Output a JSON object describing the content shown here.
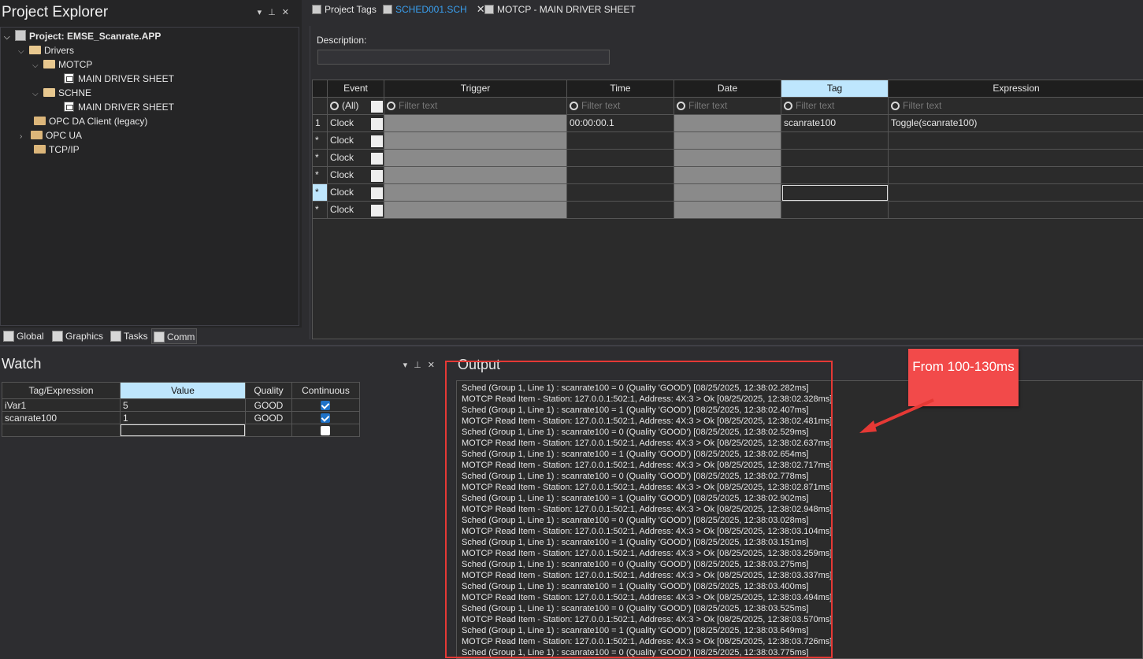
{
  "project_explorer": {
    "title": "Project Explorer",
    "tree": [
      {
        "label": "Project: EMSE_Scanrate.APP",
        "icon": "project-icon"
      },
      {
        "label": "Drivers",
        "icon": "folder-open-icon"
      },
      {
        "label": "MOTCP",
        "icon": "folder-open-icon"
      },
      {
        "label": "MAIN DRIVER SHEET",
        "icon": "driver-sheet-icon"
      },
      {
        "label": "SCHNE",
        "icon": "folder-open-icon"
      },
      {
        "label": "MAIN DRIVER SHEET",
        "icon": "driver-sheet-icon"
      },
      {
        "label": "OPC DA Client (legacy)",
        "icon": "folder-icon"
      },
      {
        "label": "OPC UA",
        "icon": "folder-icon"
      },
      {
        "label": "TCP/IP",
        "icon": "folder-icon"
      }
    ],
    "bottom_tabs": [
      "Global",
      "Graphics",
      "Tasks",
      "Comm"
    ]
  },
  "doc_tabs": [
    {
      "label": "Project Tags"
    },
    {
      "label": "SCHED001.SCH"
    },
    {
      "label": "MOTCP - MAIN DRIVER SHEET"
    }
  ],
  "schedule": {
    "description_label": "Description:",
    "columns": [
      "Event",
      "Trigger",
      "Time",
      "Date",
      "Tag",
      "Expression"
    ],
    "filter_all": "(All)",
    "filter_placeholder": "Filter text",
    "rows": [
      {
        "marker": "1",
        "event": "Clock",
        "time": "00:00:00.1",
        "tag": "scanrate100",
        "expression": "Toggle(scanrate100)"
      },
      {
        "marker": "*",
        "event": "Clock",
        "time": "",
        "tag": "",
        "expression": ""
      },
      {
        "marker": "*",
        "event": "Clock",
        "time": "",
        "tag": "",
        "expression": ""
      },
      {
        "marker": "*",
        "event": "Clock",
        "time": "",
        "tag": "",
        "expression": ""
      },
      {
        "marker": "*",
        "event": "Clock",
        "time": "",
        "tag": "",
        "expression": ""
      },
      {
        "marker": "*",
        "event": "Clock",
        "time": "",
        "tag": "",
        "expression": ""
      }
    ]
  },
  "watch": {
    "title": "Watch",
    "columns": [
      "Tag/Expression",
      "Value",
      "Quality",
      "Continuous"
    ],
    "rows": [
      {
        "tag": "iVar1",
        "value": "5",
        "quality": "GOOD",
        "continuous": true
      },
      {
        "tag": "scanrate100",
        "value": "1",
        "quality": "GOOD",
        "continuous": true
      }
    ]
  },
  "output": {
    "title": "Output",
    "lines": [
      "Sched (Group 1, Line 1) : scanrate100 = 0 (Quality 'GOOD') [08/25/2025, 12:38:02.282ms]",
      "MOTCP Read Item - Station: 127.0.0.1:502:1, Address: 4X:3 > Ok [08/25/2025, 12:38:02.328ms]",
      "Sched (Group 1, Line 1) : scanrate100 = 1 (Quality 'GOOD') [08/25/2025, 12:38:02.407ms]",
      "MOTCP Read Item - Station: 127.0.0.1:502:1, Address: 4X:3 > Ok [08/25/2025, 12:38:02.481ms]",
      "Sched (Group 1, Line 1) : scanrate100 = 0 (Quality 'GOOD') [08/25/2025, 12:38:02.529ms]",
      "MOTCP Read Item - Station: 127.0.0.1:502:1, Address: 4X:3 > Ok [08/25/2025, 12:38:02.637ms]",
      "Sched (Group 1, Line 1) : scanrate100 = 1 (Quality 'GOOD') [08/25/2025, 12:38:02.654ms]",
      "MOTCP Read Item - Station: 127.0.0.1:502:1, Address: 4X:3 > Ok [08/25/2025, 12:38:02.717ms]",
      "Sched (Group 1, Line 1) : scanrate100 = 0 (Quality 'GOOD') [08/25/2025, 12:38:02.778ms]",
      "MOTCP Read Item - Station: 127.0.0.1:502:1, Address: 4X:3 > Ok [08/25/2025, 12:38:02.871ms]",
      "Sched (Group 1, Line 1) : scanrate100 = 1 (Quality 'GOOD') [08/25/2025, 12:38:02.902ms]",
      "MOTCP Read Item - Station: 127.0.0.1:502:1, Address: 4X:3 > Ok [08/25/2025, 12:38:02.948ms]",
      "Sched (Group 1, Line 1) : scanrate100 = 0 (Quality 'GOOD') [08/25/2025, 12:38:03.028ms]",
      "MOTCP Read Item - Station: 127.0.0.1:502:1, Address: 4X:3 > Ok [08/25/2025, 12:38:03.104ms]",
      "Sched (Group 1, Line 1) : scanrate100 = 1 (Quality 'GOOD') [08/25/2025, 12:38:03.151ms]",
      "MOTCP Read Item - Station: 127.0.0.1:502:1, Address: 4X:3 > Ok [08/25/2025, 12:38:03.259ms]",
      "Sched (Group 1, Line 1) : scanrate100 = 0 (Quality 'GOOD') [08/25/2025, 12:38:03.275ms]",
      "MOTCP Read Item - Station: 127.0.0.1:502:1, Address: 4X:3 > Ok [08/25/2025, 12:38:03.337ms]",
      "Sched (Group 1, Line 1) : scanrate100 = 1 (Quality 'GOOD') [08/25/2025, 12:38:03.400ms]",
      "MOTCP Read Item - Station: 127.0.0.1:502:1, Address: 4X:3 > Ok [08/25/2025, 12:38:03.494ms]",
      "Sched (Group 1, Line 1) : scanrate100 = 0 (Quality 'GOOD') [08/25/2025, 12:38:03.525ms]",
      "MOTCP Read Item - Station: 127.0.0.1:502:1, Address: 4X:3 > Ok [08/25/2025, 12:38:03.570ms]",
      "Sched (Group 1, Line 1) : scanrate100 = 1 (Quality 'GOOD') [08/25/2025, 12:38:03.649ms]",
      "MOTCP Read Item - Station: 127.0.0.1:502:1, Address: 4X:3 > Ok [08/25/2025, 12:38:03.726ms]",
      "Sched (Group 1, Line 1) : scanrate100 = 0 (Quality 'GOOD') [08/25/2025, 12:38:03.775ms]"
    ]
  },
  "annotation": {
    "callout_text": "From 100-130ms",
    "color": "#f24a4a"
  },
  "colors": {
    "accent_tab": "#3aa0f0",
    "selected_header": "#bee6fd",
    "checkbox_on": "#1f72c7"
  }
}
